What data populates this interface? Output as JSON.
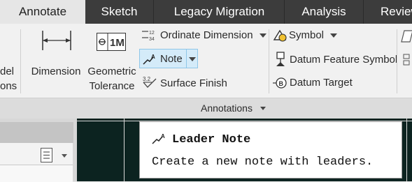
{
  "tabs": [
    "Annotate",
    "Sketch",
    "Legacy Migration",
    "Analysis",
    "Review"
  ],
  "ribbon": {
    "left_partial": [
      "del",
      "ons"
    ],
    "dimension_label": "Dimension",
    "geometric_tolerance": [
      "Geometric",
      "Tolerance"
    ],
    "ordinate_dimension_label": "Ordinate Dimension",
    "note_label": "Note",
    "surface_finish_label": "Surface Finish",
    "symbol_label": "Symbol",
    "datum_feature_symbol_label": "Datum Feature Symbol",
    "datum_target_label": "Datum Target",
    "group_label": "Annotations"
  },
  "tooltip": {
    "title": "Leader Note",
    "description": "Create a new note with leaders."
  },
  "colors": {
    "tabbar": "#3c3c3c",
    "ribbon": "#f1f1f1",
    "highlight": "#d4ebf9",
    "canvas": "#0c2320"
  },
  "icons": [
    "dimension-icon",
    "geometric-tolerance-icon",
    "ordinate-dimension-icon",
    "note-icon",
    "surface-finish-icon",
    "symbol-icon",
    "datum-feature-symbol-icon",
    "datum-target-icon",
    "list-view-icon"
  ]
}
